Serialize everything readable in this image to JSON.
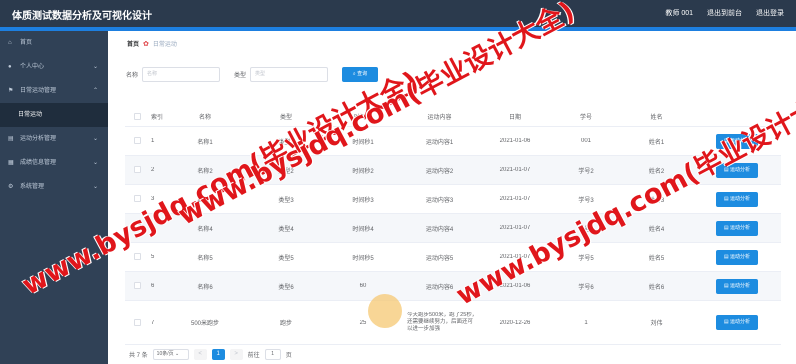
{
  "header": {
    "title": "体质测试数据分析及可视化设计",
    "user": "教师 001",
    "back_label": "退出到前台",
    "logout_label": "退出登录"
  },
  "sidebar": {
    "items": [
      {
        "label": "首页",
        "icon": "home-icon",
        "chevron": false
      },
      {
        "label": "个人中心",
        "icon": "user-icon",
        "chevron": true
      },
      {
        "label": "日常运动管理",
        "icon": "flag-icon",
        "chevron": true
      },
      {
        "label": "日常运动",
        "icon": "",
        "chevron": false,
        "sub": true
      },
      {
        "label": "运动分析管理",
        "icon": "chart-icon",
        "chevron": true
      },
      {
        "label": "成绩信息管理",
        "icon": "document-icon",
        "chevron": true
      },
      {
        "label": "系统管理",
        "icon": "gear-icon",
        "chevron": true
      }
    ]
  },
  "breadcrumb": {
    "home": "首页",
    "current": "日常运动"
  },
  "search": {
    "name_label": "名称",
    "name_placeholder": "名称",
    "type_label": "类型",
    "type_placeholder": "类型",
    "button_label": "查询"
  },
  "table": {
    "headers": [
      "索引",
      "名称",
      "类型",
      "时间秒",
      "运动内容",
      "日期",
      "学号",
      "姓名"
    ],
    "rows": [
      {
        "idx": "1",
        "name": "名称1",
        "type": "类型1",
        "time": "时间秒1",
        "content": "运动内容1",
        "date": "2021-01-06",
        "no": "001",
        "person": "姓名1"
      },
      {
        "idx": "2",
        "name": "名称2",
        "type": "类型2",
        "time": "时间秒2",
        "content": "运动内容2",
        "date": "2021-01-07",
        "no": "学号2",
        "person": "姓名2"
      },
      {
        "idx": "3",
        "name": "名称3",
        "type": "类型3",
        "time": "时间秒3",
        "content": "运动内容3",
        "date": "2021-01-07",
        "no": "学号3",
        "person": "姓名3"
      },
      {
        "idx": "4",
        "name": "名称4",
        "type": "类型4",
        "time": "时间秒4",
        "content": "运动内容4",
        "date": "2021-01-07",
        "no": "学号4",
        "person": "姓名4"
      },
      {
        "idx": "5",
        "name": "名称5",
        "type": "类型5",
        "time": "时间秒5",
        "content": "运动内容5",
        "date": "2021-01-07",
        "no": "学号5",
        "person": "姓名5"
      },
      {
        "idx": "6",
        "name": "名称6",
        "type": "类型6",
        "time": "60",
        "content": "运动内容6",
        "date": "2021-01-06",
        "no": "学号6",
        "person": "姓名6"
      },
      {
        "idx": "7",
        "name": "500米跑步",
        "type": "跑步",
        "time": "25",
        "content": "今天跑步500米，跑了25秒，还需要继续努力，后面还可以进一步加强",
        "date": "2020-12-26",
        "no": "1",
        "person": "刘伟"
      }
    ],
    "action_label": "运动分析"
  },
  "pager": {
    "total": "共 7 条",
    "page_size": "10条/页",
    "prev": "<",
    "current": "1",
    "next": ">",
    "goto_label": "前往",
    "goto_value": "1",
    "page_suffix": "页"
  },
  "watermark": {
    "a": "www.bysjdq.com(毕业设计大全)",
    "b": "www.bysjdq.com(毕业设计大全)",
    "c": "www.bysjdq.com(毕业设计大全)"
  },
  "colors": {
    "topbar": "#2b3a4d",
    "accent": "#1d7fe0",
    "sidebar": "#304156",
    "primary": "#1d8ce0",
    "watermark": "#e0161b"
  }
}
